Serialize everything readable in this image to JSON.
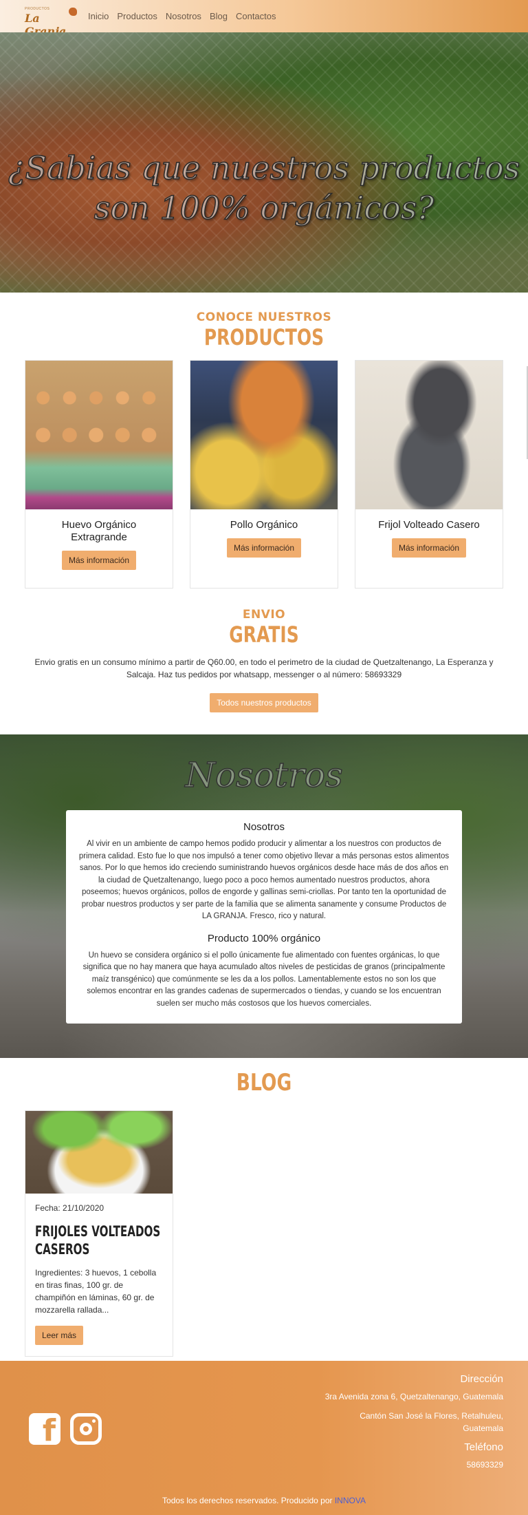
{
  "nav": {
    "logo_small": "PRODUCTOS",
    "logo_text": "La Granja",
    "links": [
      "Inicio",
      "Productos",
      "Nosotros",
      "Blog",
      "Contactos"
    ]
  },
  "hero": {
    "line1": "¿Sabias que nuestros productos",
    "line2": "son 100% orgánicos?"
  },
  "products_section": {
    "subtitle": "CONOCE NUESTROS",
    "title": "PRODUCTOS",
    "items": [
      {
        "name": "Huevo Orgánico Extragrande",
        "button": "Más información"
      },
      {
        "name": "Pollo Orgánico",
        "button": "Más información"
      },
      {
        "name": "Frijol Volteado Casero",
        "button": "Más información"
      }
    ]
  },
  "envio": {
    "subtitle": "ENVIO",
    "title": "GRATIS",
    "text": "Envio gratis en un consumo mínimo a partir de Q60.00, en todo el perimetro de la ciudad de Quetzaltenango, La Esperanza y Salcaja. Haz tus pedidos por whatsapp, messenger o al número: 58693329",
    "button": "Todos nuestros productos"
  },
  "nosotros": {
    "banner": "Nosotros",
    "heading1": "Nosotros",
    "text1": "Al vivir en un ambiente de campo hemos podido producir y alimentar a los nuestros con productos de primera calidad. Esto fue lo que nos impulsó a tener como objetivo llevar a más personas estos alimentos sanos. Por lo que hemos ido creciendo suministrando huevos orgánicos desde hace más de dos años en la ciudad de Quetzaltenango, luego poco a poco hemos aumentado nuestros productos, ahora poseemos; huevos orgánicos, pollos de engorde y gallinas semi-criollas. Por tanto ten la oportunidad de probar nuestros productos y ser parte de la familia que se alimenta sanamente y consume Productos de LA GRANJA. Fresco, rico y natural.",
    "heading2": "Producto 100% orgánico",
    "text2": "Un huevo se considera orgánico si el pollo únicamente fue alimentado con fuentes orgánicas, lo que significa que no hay manera que haya acumulado altos niveles de pesticidas de granos (principalmente maíz transgénico) que comúnmente se les da a los pollos. Lamentablemente estos no son los que solemos encontrar en las grandes cadenas de supermercados o tiendas, y cuando se los encuentran suelen ser mucho más costosos que los huevos comerciales."
  },
  "blog": {
    "title": "BLOG",
    "post": {
      "date": "Fecha: 21/10/2020",
      "title": "FRIJOLES VOLTEADOS CASEROS",
      "excerpt": "Ingredientes: 3 huevos, 1 cebolla en tiras finas, 100 gr. de champiñón en láminas, 60 gr. de mozzarella rallada...",
      "button": "Leer más"
    }
  },
  "footer": {
    "direccion_label": "Dirección",
    "address1": "3ra Avenida zona 6, Quetzaltenango, Guatemala",
    "address2": "Cantón San José la Flores, Retalhuleu, Guatemala",
    "telefono_label": "Teléfono",
    "phone": "58693329",
    "copyright": "Todos los derechos reservados. Producido por",
    "brand": "INNOVA",
    "icons": [
      "facebook-icon",
      "instagram-icon"
    ]
  },
  "colors": {
    "accent": "#e39a50",
    "button": "#f0ad6e",
    "footer": "#e0914a"
  }
}
